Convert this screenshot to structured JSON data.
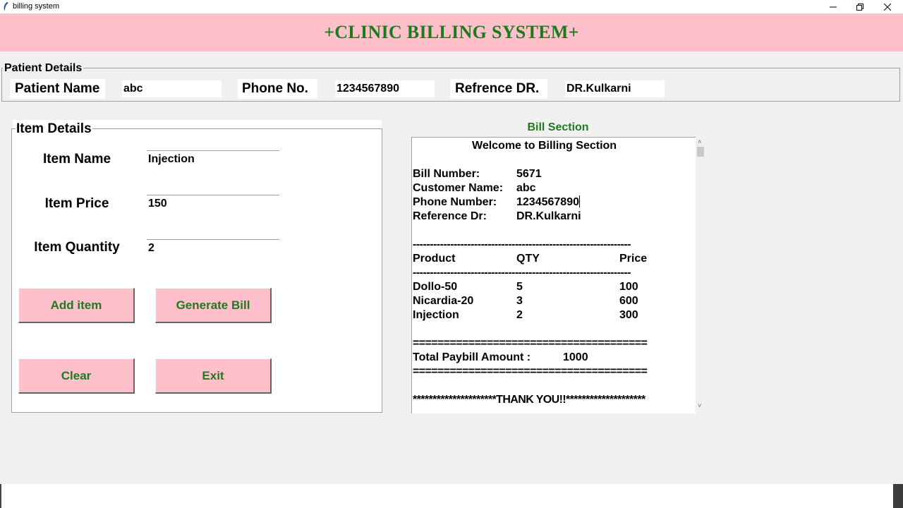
{
  "window": {
    "title": "billing system",
    "minimize_icon": "minimize-icon",
    "restore_icon": "restore-icon",
    "close_icon": "close-icon"
  },
  "header": {
    "title": "+CLINIC BILLING SYSTEM+"
  },
  "patient_details": {
    "legend": "Patient Details",
    "patient_name_label": "Patient Name",
    "patient_name_value": "abc",
    "phone_label": "Phone No.",
    "phone_value": "1234567890",
    "ref_dr_label": "Refrence DR.",
    "ref_dr_value": "DR.Kulkarni"
  },
  "item_details": {
    "legend": "Item Details",
    "item_name_label": "Item Name",
    "item_name_value": "Injection",
    "item_price_label": "Item Price",
    "item_price_value": "150",
    "item_quantity_label": "Item Quantity",
    "item_quantity_value": "2",
    "add_button": "Add item",
    "generate_button": "Generate Bill",
    "clear_button": "Clear",
    "exit_button": "Exit"
  },
  "bill": {
    "heading": "Bill Section",
    "welcome": "Welcome to Billing Section",
    "bill_number_label": "Bill Number:",
    "bill_number_value": "5671",
    "customer_label": "Customer Name:",
    "customer_value": "abc",
    "phone_label": "Phone Number:",
    "phone_value": "1234567890",
    "ref_label": "Reference Dr:",
    "ref_value": "DR.Kulkarni",
    "dash_line": "----------------------------------------------------------------",
    "col_product": "Product",
    "col_qty": "QTY",
    "col_price": "Price",
    "items": [
      {
        "product": "Dollo-50",
        "qty": "5",
        "price": "100"
      },
      {
        "product": "Nicardia-20",
        "qty": "3",
        "price": "600"
      },
      {
        "product": "Injection",
        "qty": "2",
        "price": "300"
      }
    ],
    "eq_line": "======================================",
    "total_label": "Total Paybill Amount :",
    "total_value": "1000",
    "thank_you": "*********************THANK YOU!!********************"
  }
}
